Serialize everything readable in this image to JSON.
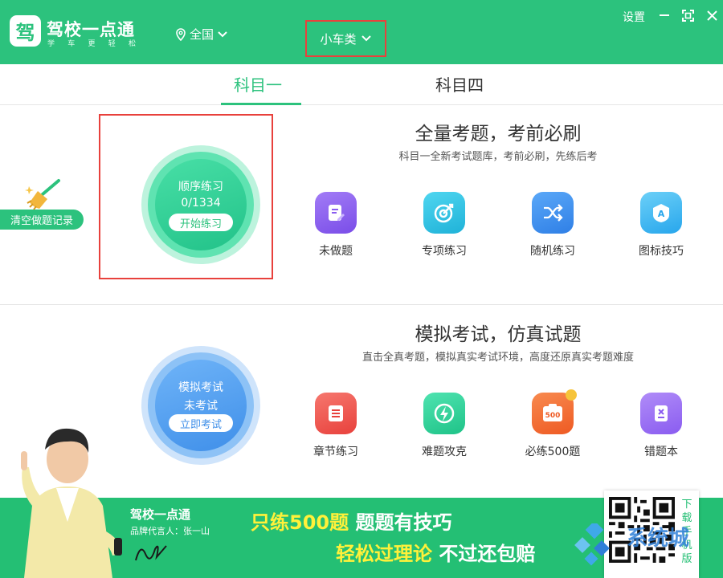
{
  "app": {
    "logo_char": "驾",
    "title": "驾校一点通",
    "subtitle_chars": [
      "学",
      "车",
      "更",
      "轻",
      "松"
    ],
    "region": "全国",
    "vehicle": "小车类",
    "settings": "设置"
  },
  "tabs": [
    {
      "label": "科目一",
      "active": true
    },
    {
      "label": "科目四",
      "active": false
    }
  ],
  "clear_records": "清空做题记录",
  "section1": {
    "title": "全量考题，考前必刷",
    "subtitle": "科目一全新考试题库，考前必刷，先练后考",
    "circle": {
      "title": "顺序练习",
      "progress": "0/1334",
      "button": "开始练习"
    },
    "features": [
      {
        "label": "未做题",
        "icon": "edit-doc-icon",
        "color": "#8a5cf0"
      },
      {
        "label": "专项练习",
        "icon": "target-icon",
        "color": "#2dc0e0"
      },
      {
        "label": "随机练习",
        "icon": "shuffle-icon",
        "color": "#3d8ef0"
      },
      {
        "label": "图标技巧",
        "icon": "sign-icon",
        "color": "#3fb7f0"
      }
    ]
  },
  "section2": {
    "title": "模拟考试，仿真试题",
    "subtitle": "直击全真考题，模拟真实考试环境，高度还原真实考题难度",
    "circle": {
      "title": "模拟考试",
      "status": "未考试",
      "button": "立即考试"
    },
    "features": [
      {
        "label": "章节练习",
        "icon": "list-icon",
        "color": "#f05a4f"
      },
      {
        "label": "难题攻克",
        "icon": "bolt-icon",
        "color": "#2fd29a"
      },
      {
        "label": "必练500题",
        "icon": "500-icon",
        "color": "#f36a2e"
      },
      {
        "label": "错题本",
        "icon": "wrong-book-icon",
        "color": "#9a6cf0"
      }
    ]
  },
  "banner": {
    "brand": "驾校一点通",
    "spokesperson": "品牌代言人：张一山",
    "line1_highlight": "只练500题",
    "line1_rest": "题题有技巧",
    "line2_highlight": "轻松过理论",
    "line2_rest": "不过还包赔",
    "download_chars": [
      "下",
      "载",
      "手",
      "机",
      "版"
    ],
    "watermark": "系统城"
  },
  "colors": {
    "brand": "#2cc27d",
    "highlight_frame": "#e8413c"
  }
}
